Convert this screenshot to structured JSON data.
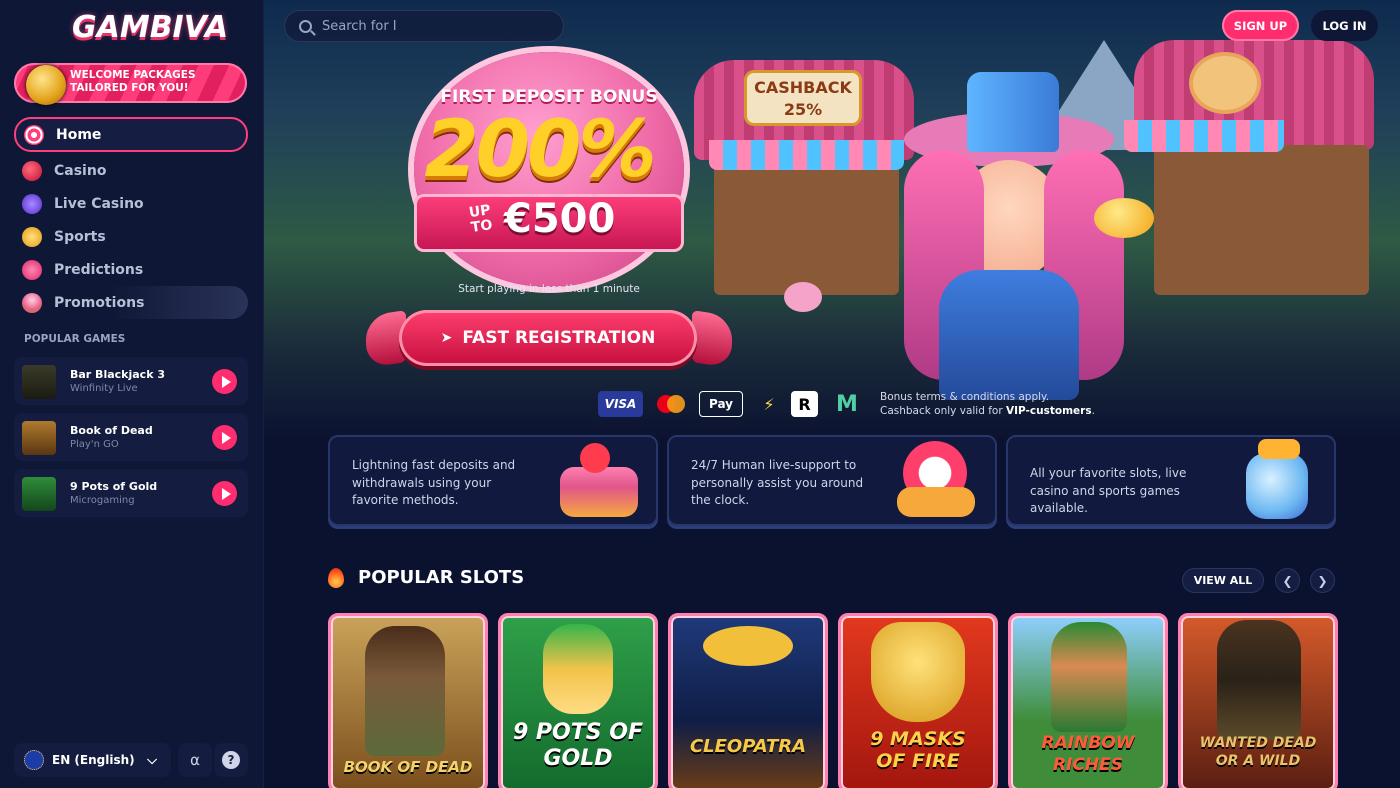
{
  "brand": {
    "logo_text": "GAMBIVA"
  },
  "sidebar": {
    "promo_banner": "WELCOME PACKAGES TAILORED FOR YOU!",
    "nav": [
      {
        "label": "Home",
        "icon": "swirl-lollipop-icon",
        "active": true
      },
      {
        "label": "Casino",
        "icon": "cherry-icon"
      },
      {
        "label": "Live Casino",
        "icon": "star-chip-icon"
      },
      {
        "label": "Sports",
        "icon": "trophy-icon"
      },
      {
        "label": "Predictions",
        "icon": "chart-up-icon"
      },
      {
        "label": "Promotions",
        "icon": "cupcake-icon"
      }
    ],
    "popular_games_title": "POPULAR GAMES",
    "popular_games": [
      {
        "name": "Bar Blackjack 3",
        "provider": "Winfinity Live"
      },
      {
        "name": "Book of Dead",
        "provider": "Play'n GO"
      },
      {
        "name": "9 Pots of Gold",
        "provider": "Microgaming"
      }
    ],
    "language": "EN (English)"
  },
  "header": {
    "search_placeholder": "Search for I",
    "signup_label": "SIGN UP",
    "login_label": "LOG IN"
  },
  "hero": {
    "shop_sign": "CASHBACK 25%",
    "bonus_title": "FIRST DEPOSIT BONUS",
    "bonus_amount": "200%",
    "bonus_upto": "UP TO",
    "bonus_max": "€500",
    "subtitle": "Start playing in less than 1 minute",
    "cta_label": "FAST REGISTRATION",
    "payments": [
      "VISA",
      "Mastercard",
      "Apple Pay",
      "Instant bank",
      "Revolut",
      "MiFinity"
    ],
    "terms_line1": "Bonus terms & conditions apply.",
    "terms_line2_prefix": "Cashback only valid for ",
    "terms_line2_bold": "VIP-customers",
    "terms_line2_suffix": "."
  },
  "features": [
    {
      "text": "Lightning fast deposits and withdrawals using your favorite methods.",
      "art": "cake-icon"
    },
    {
      "text": "24/7 Human live-support to personally assist you around the clock.",
      "art": "clock-icon"
    },
    {
      "text": "All your favorite slots, live casino and sports games available.",
      "art": "candy-jar-icon"
    }
  ],
  "popular_slots": {
    "title": "POPULAR SLOTS",
    "view_all_label": "VIEW ALL",
    "slots": [
      {
        "title": "BOOK OF DEAD",
        "bg": "#8a5a24"
      },
      {
        "title": "9 POTS OF GOLD",
        "bg": "#1f7a35"
      },
      {
        "title": "CLEOPATRA",
        "bg": "#1b2f66"
      },
      {
        "title": "9 MASKS OF FIRE",
        "bg": "#c6281a"
      },
      {
        "title": "RAINBOW RICHES",
        "bg": "#3f8d3a"
      },
      {
        "title": "WANTED DEAD OR A WILD",
        "bg": "#6e2a1a"
      }
    ]
  },
  "colors": {
    "accent": "#ff2d6f",
    "sidebar_bg": "#0f1736",
    "page_bg": "#0b1230",
    "gold": "#ffd027"
  }
}
